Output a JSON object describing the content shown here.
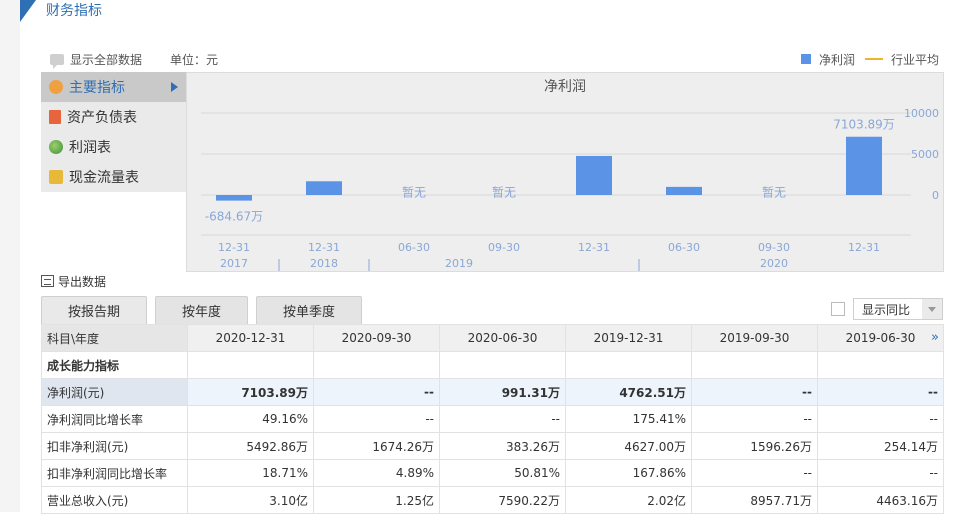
{
  "page": {
    "title": "财务指标"
  },
  "toolbar": {
    "show_all": "显示全部数据",
    "unit": "单位：元"
  },
  "legend": {
    "series1": "净利润",
    "series2": "行业平均",
    "series1_color": "#5b93e6",
    "series2_color": "#f2b22e"
  },
  "menu": [
    {
      "label": "主要指标",
      "icon": "gear-icon"
    },
    {
      "label": "资产负债表",
      "icon": "document-icon"
    },
    {
      "label": "利润表",
      "icon": "globe-icon"
    },
    {
      "label": "现金流量表",
      "icon": "money-icon"
    }
  ],
  "chart_data": {
    "type": "bar",
    "title": "净利润",
    "categories": [
      "12-31",
      "12-31",
      "06-30",
      "09-30",
      "12-31",
      "06-30",
      "09-30",
      "12-31"
    ],
    "years": [
      "2017",
      "2018",
      "2019",
      "2020"
    ],
    "series": [
      {
        "name": "净利润",
        "values": [
          -684.67,
          1674.26,
          null,
          null,
          4762.51,
          991.31,
          null,
          7103.89
        ]
      }
    ],
    "value_labels": [
      "-684.67万",
      "",
      "暂无",
      "暂无",
      "",
      "",
      "暂无",
      "7103.89万"
    ],
    "yticks": [
      "10000",
      "5000",
      "0"
    ],
    "ylim": [
      -1500,
      10000
    ]
  },
  "export": {
    "label": "导出数据"
  },
  "tabs": [
    "按报告期",
    "按年度",
    "按单季度"
  ],
  "yoy": {
    "label": "显示同比"
  },
  "table": {
    "header": [
      "科目\\年度",
      "2020-12-31",
      "2020-09-30",
      "2020-06-30",
      "2019-12-31",
      "2019-09-30",
      "2019-06-30"
    ],
    "section": "成长能力指标",
    "rows": [
      [
        "净利润(元)",
        "7103.89万",
        "--",
        "991.31万",
        "4762.51万",
        "--",
        "--"
      ],
      [
        "净利润同比增长率",
        "49.16%",
        "--",
        "--",
        "175.41%",
        "--",
        "--"
      ],
      [
        "扣非净利润(元)",
        "5492.86万",
        "1674.26万",
        "383.26万",
        "4627.00万",
        "1596.26万",
        "254.14万"
      ],
      [
        "扣非净利润同比增长率",
        "18.71%",
        "4.89%",
        "50.81%",
        "167.86%",
        "--",
        "--"
      ],
      [
        "营业总收入(元)",
        "3.10亿",
        "1.25亿",
        "7590.22万",
        "2.02亿",
        "8957.71万",
        "4463.16万"
      ]
    ],
    "more": "»"
  }
}
